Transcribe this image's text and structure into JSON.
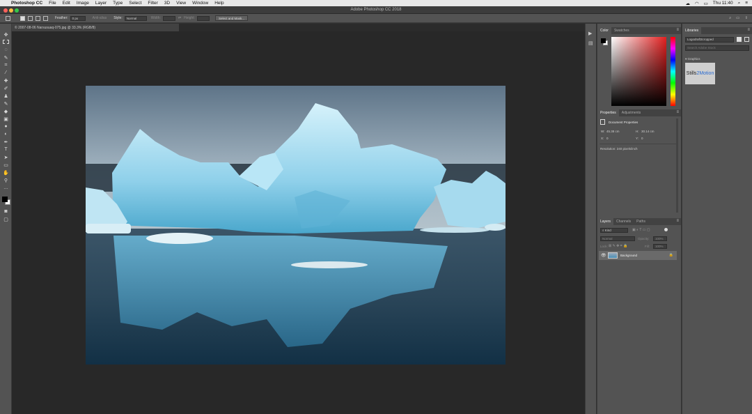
{
  "menubar": {
    "app": "Photoshop CC",
    "items": [
      "File",
      "Edit",
      "Image",
      "Layer",
      "Type",
      "Select",
      "Filter",
      "3D",
      "View",
      "Window",
      "Help"
    ],
    "clock": "Thu 11:40"
  },
  "window": {
    "title": "Adobe Photoshop CC 2018"
  },
  "options": {
    "feather_label": "Feather:",
    "feather_value": "0 px",
    "antialias_label": "Anti-alias",
    "style_label": "Style:",
    "style_value": "Normal",
    "width_label": "Width:",
    "height_label": "Height:",
    "select_mask": "Select and Mask..."
  },
  "document": {
    "tab": "© 2007-08-06 Narsusuaq-075.jpg @ 33.3% (RGB/8)"
  },
  "color_panel": {
    "tabs": [
      "Color",
      "Swatches"
    ]
  },
  "properties_panel": {
    "tabs": [
      "Properties",
      "Adjustments"
    ],
    "heading": "Document Properties",
    "w_label": "W:",
    "w_value": "45.38 cm",
    "h_label": "H:",
    "h_value": "30.14 cm",
    "x_label": "X:",
    "x_value": "0",
    "y_label": "Y:",
    "y_value": "0",
    "resolution": "Resolution: 240 pixels/inch"
  },
  "layers_panel": {
    "tabs": [
      "Layers",
      "Channels",
      "Paths"
    ],
    "kind": "Kind",
    "blend": "Normal",
    "opacity_label": "Opacity:",
    "opacity_value": "100%",
    "lock_label": "Lock:",
    "fill_label": "Fill:",
    "fill_value": "100%",
    "layer_name": "Background"
  },
  "libraries_panel": {
    "tab": "Libraries",
    "library": "Logodraft3cropped",
    "search_placeholder": "Search Adobe Stock",
    "section": "Graphics",
    "thumb_a": "Stills",
    "thumb_b": "2Motion"
  },
  "colors": {
    "accent": "#1473e6",
    "bg": "#535353",
    "canvas": "#282828"
  }
}
